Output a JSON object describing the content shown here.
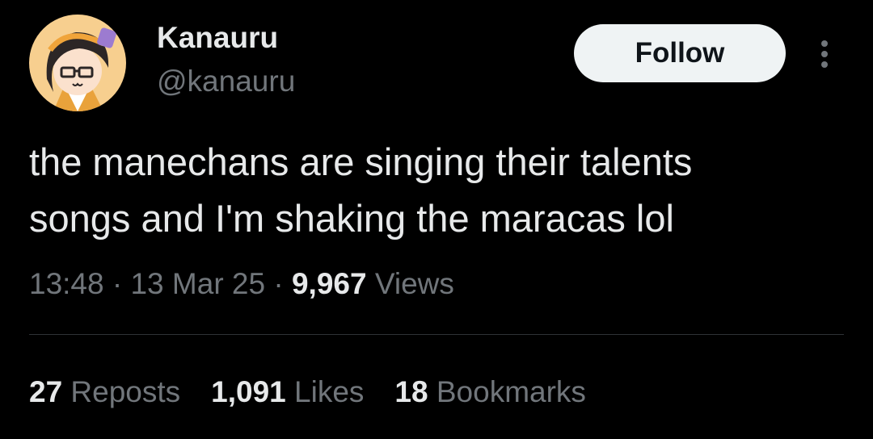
{
  "author": {
    "display_name": "Kanauru",
    "handle": "@kanauru"
  },
  "follow_label": "Follow",
  "tweet": {
    "lines": [
      "the manechans are singing their talents",
      "songs and I'm shaking the maracas lol"
    ]
  },
  "meta": {
    "time": "13:48",
    "separator": " · ",
    "date": "13 Mar 25",
    "views_count": "9,967",
    "views_label": " Views"
  },
  "stats": {
    "reposts": {
      "count": "27",
      "label": " Reposts"
    },
    "likes": {
      "count": "1,091",
      "label": " Likes"
    },
    "bookmarks": {
      "count": "18",
      "label": " Bookmarks"
    }
  },
  "colors": {
    "background": "#000000",
    "primary_text": "#e7e9ea",
    "secondary_text": "#71767b",
    "follow_button_bg": "#eff3f4",
    "avatar_bg": "#f7cf8f"
  },
  "icons": {
    "more": "more-vertical-icon"
  }
}
